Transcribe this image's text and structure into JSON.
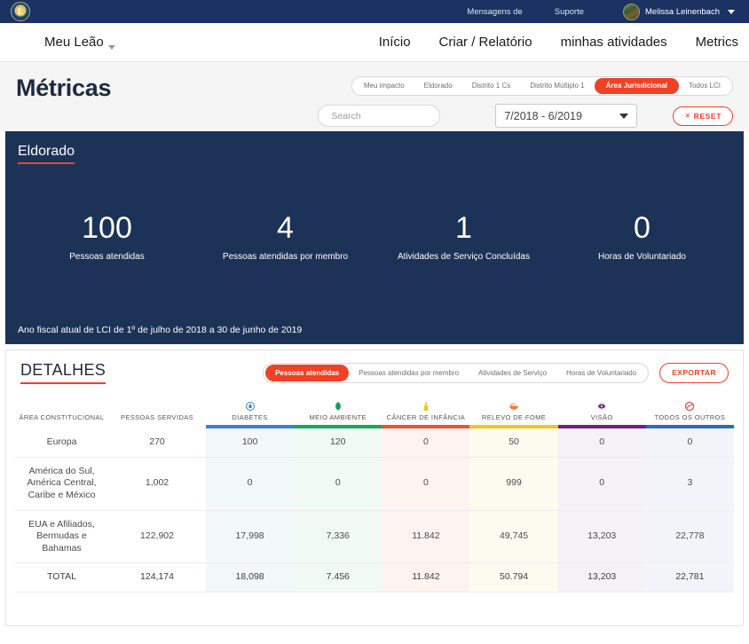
{
  "utility_bar": {
    "logo_icon": "lions-club-logo",
    "links": [
      {
        "label": "Mensagens de"
      },
      {
        "label": "Suporte"
      }
    ],
    "user": {
      "name": "Melissa Leinenbach",
      "avatar_icon": "user-avatar",
      "caret_icon": "chevron-down-icon"
    }
  },
  "main_nav": {
    "brand": "Meu Leão",
    "brand_caret_icon": "chevron-down-icon",
    "links": [
      {
        "label": "Início"
      },
      {
        "label": "Criar / Relatório"
      },
      {
        "label": "minhas atividades"
      },
      {
        "label": "Metrics"
      }
    ]
  },
  "page_header": {
    "title": "Métricas",
    "scope_tabs": [
      {
        "label": "Meu impacto",
        "active": false
      },
      {
        "label": "Eldorado",
        "active": false
      },
      {
        "label": "Distrito 1 Cs",
        "active": false
      },
      {
        "label": "Distrito Múltiplo 1",
        "active": false
      },
      {
        "label": "Área Jurisdicional",
        "active": true
      },
      {
        "label": "Todos LCI",
        "active": false
      }
    ],
    "search": {
      "placeholder": "Search",
      "value": "",
      "icon": "search-input"
    },
    "date_range": {
      "value": "7/2018 - 6/2019",
      "caret_icon": "chevron-down-icon"
    },
    "reset_button": {
      "label": "RESET",
      "x_icon": "close-icon"
    }
  },
  "hero": {
    "scope_name": "Eldorado",
    "stats": [
      {
        "value": "100",
        "label": "Pessoas atendidas"
      },
      {
        "value": "4",
        "label": "Pessoas atendidas por membro"
      },
      {
        "value": "1",
        "label": "Atividades de Serviço Concluídas"
      },
      {
        "value": "0",
        "label": "Horas de Voluntariado"
      }
    ],
    "footnote": "Ano fiscal atual de LCI de 1º de julho de 2018 a 30 de junho de 2019"
  },
  "details": {
    "title": "DETALHES",
    "metric_tabs": [
      {
        "label": "Pessoas atendidas",
        "active": true
      },
      {
        "label": "Pessoas atendidas por membro",
        "active": false
      },
      {
        "label": "Atividades de Serviço",
        "active": false
      },
      {
        "label": "Horas de Voluntariado",
        "active": false
      }
    ],
    "export_button": {
      "label": "EXPORTAR"
    }
  },
  "chart_data": {
    "type": "table",
    "title": "DETALHES",
    "columns": [
      {
        "label": "ÁREA CONSTITUCIONAL",
        "icon": "",
        "bar_color": "",
        "tint_class": ""
      },
      {
        "label": "PESSOAS SERVIDAS",
        "icon": "",
        "bar_color": "",
        "tint_class": ""
      },
      {
        "label": "DIABETES",
        "icon": "diabetes-drop-icon",
        "bar_color": "#3d7fd4",
        "tint_class": "tint-diabetes"
      },
      {
        "label": "MEIO AMBIENTE",
        "icon": "leaf-icon",
        "bar_color": "#16a75c",
        "tint_class": "tint-environment"
      },
      {
        "label": "CÂNCER DE INFÂNCIA",
        "icon": "childhood-cancer-ribbon-icon",
        "bar_color": "#ef5330",
        "tint_class": "tint-cancer"
      },
      {
        "label": "RELEVO DE FOME",
        "icon": "hunger-bowl-icon",
        "bar_color": "#edc722",
        "tint_class": "tint-hunger"
      },
      {
        "label": "VISÃO",
        "icon": "vision-eye-icon",
        "bar_color": "#6c2283",
        "tint_class": "tint-vision"
      },
      {
        "label": "TODOS OS OUTROS",
        "icon": "all-others-icon",
        "bar_color": "#2d6cb5",
        "tint_class": "tint-other"
      }
    ],
    "rows": [
      {
        "area": "Europa",
        "values": [
          "270",
          "100",
          "120",
          "0",
          "50",
          "0",
          "0"
        ],
        "total_row": false
      },
      {
        "area": "América do Sul, América Central, Caribe e México",
        "values": [
          "1,002",
          "0",
          "0",
          "0",
          "999",
          "0",
          "3"
        ],
        "total_row": false
      },
      {
        "area": "EUA e Afiliados, Bermudas e Bahamas",
        "values": [
          "122,902",
          "17,998",
          "7,336",
          "11.842",
          "49,745",
          "13,203",
          "22,778"
        ],
        "total_row": false
      },
      {
        "area": "TOTAL",
        "values": [
          "124,174",
          "18,098",
          "7.456",
          "11.842",
          "50.794",
          "13,203",
          "22,781"
        ],
        "total_row": true
      }
    ]
  },
  "colors": {
    "navy_dark": "#1b3263",
    "hero_navy": "#1d3257",
    "accent_orange": "#ef4123",
    "hero_underline": "#d94a3a"
  }
}
